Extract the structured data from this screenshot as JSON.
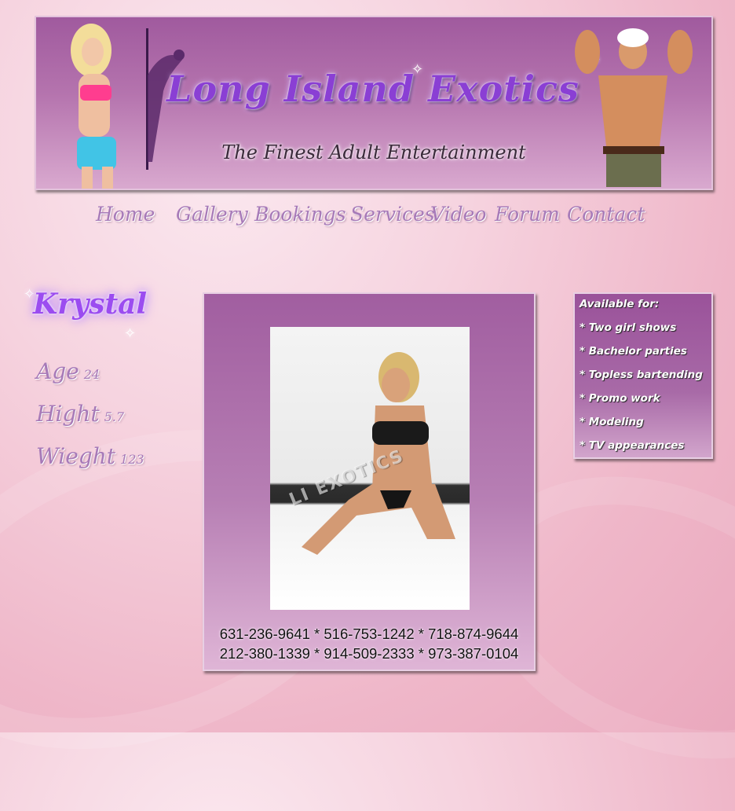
{
  "header": {
    "title": "Long Island Exotics",
    "tagline": "The Finest Adult Entertainment"
  },
  "nav": [
    "Home",
    "Gallery",
    "Bookings",
    "Services",
    "Video",
    "Forum",
    "Contact"
  ],
  "profile": {
    "name": "Krystal",
    "stats": [
      {
        "label": "Age",
        "value": "24"
      },
      {
        "label": "Hight",
        "value": "5.7"
      },
      {
        "label": "Wieght",
        "value": "123"
      }
    ]
  },
  "photo": {
    "watermark": "LI EXOTICS"
  },
  "phones": {
    "line1": "631-236-9641 * 516-753-1242 * 718-874-9644",
    "line2": "212-380-1339 * 914-509-2333 * 973-387-0104"
  },
  "available": {
    "title": "Available for:",
    "items": [
      "* Two girl shows",
      "* Bachelor parties",
      "* Topless bartending",
      "* Promo work",
      "* Modeling",
      "* TV appearances"
    ]
  },
  "colors": {
    "title": "#8a3fd4",
    "nav": "#a77ab8",
    "panel": "#a15ea0",
    "background": "#f6d3df"
  }
}
